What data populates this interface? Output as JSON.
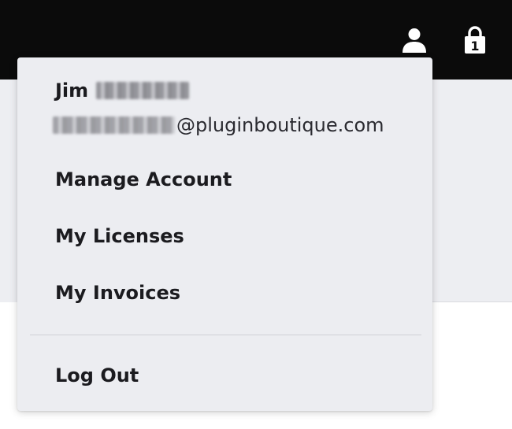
{
  "header": {
    "icons": [
      "user-icon",
      "cart-icon"
    ],
    "cart_count": "1"
  },
  "account_menu": {
    "user_first_name": "Jim",
    "email_domain": "@pluginboutique.com",
    "items": [
      {
        "label": "Manage Account"
      },
      {
        "label": "My Licenses"
      },
      {
        "label": "My Invoices"
      }
    ],
    "logout_label": "Log Out"
  },
  "colors": {
    "header_bg": "#0b0b0b",
    "menu_bg": "#ecedf1",
    "text": "#1b1b1f"
  }
}
